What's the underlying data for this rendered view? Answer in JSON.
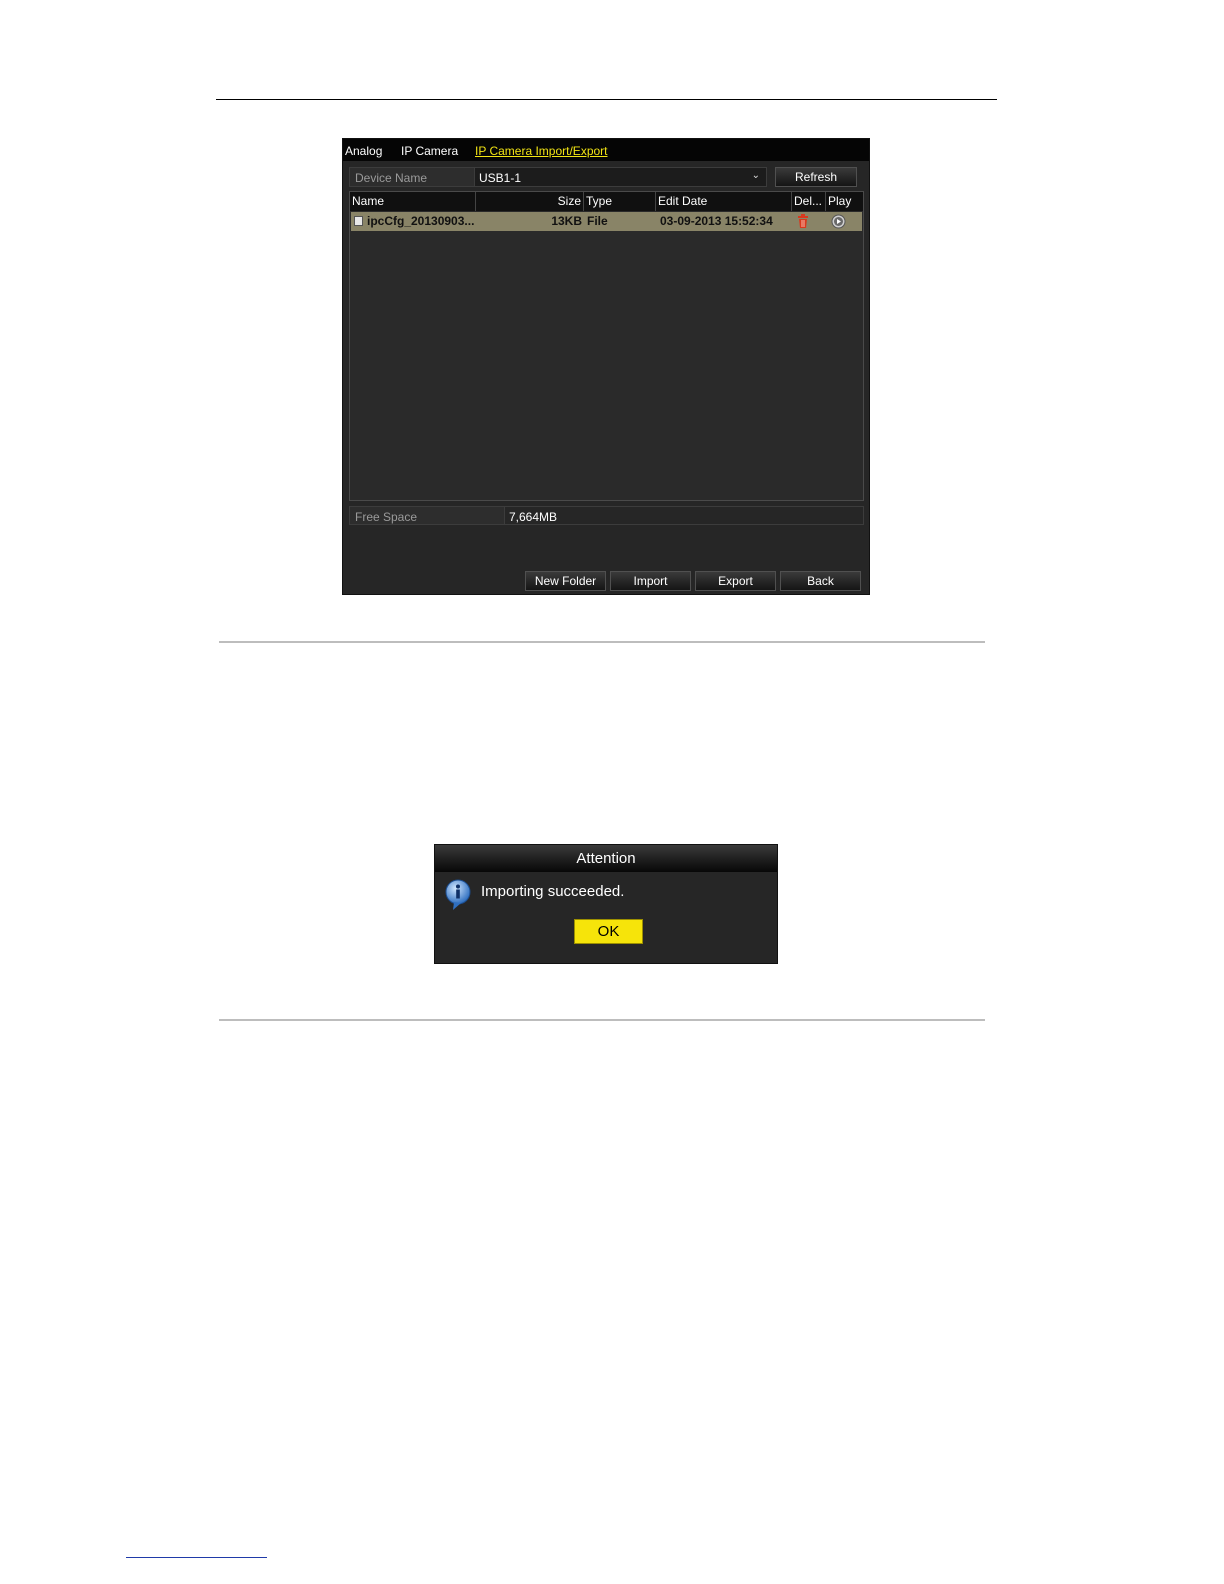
{
  "nvr_panel": {
    "tabs": [
      "Analog",
      "IP Camera",
      "IP Camera Import/Export"
    ],
    "active_tab": "IP Camera Import/Export",
    "device_name_label": "Device Name",
    "device_name_value": "USB1-1",
    "refresh_label": "Refresh",
    "table": {
      "columns": [
        "Name",
        "Size",
        "Type",
        "Edit Date",
        "Del...",
        "Play"
      ],
      "rows": [
        {
          "name": "ipcCfg_20130903...",
          "size": "13KB",
          "type": "File",
          "edit_date": "03-09-2013 15:52:34",
          "selected": true
        }
      ]
    },
    "free_space_label": "Free Space",
    "free_space_value": "7,664MB",
    "buttons": {
      "new_folder": "New Folder",
      "import": "Import",
      "export": "Export",
      "back": "Back"
    },
    "colors": {
      "accent_tab": "#f3e514",
      "selected_row": "#898467",
      "delete_icon": "#d9381e"
    },
    "icons": [
      "file-icon",
      "delete-icon",
      "play-icon",
      "chevron-down-icon"
    ]
  },
  "attention_dialog": {
    "title": "Attention",
    "message": "Importing succeeded.",
    "ok_label": "OK",
    "icons": [
      "info-icon"
    ],
    "colors": {
      "ok_button": "#f6e40a"
    }
  }
}
